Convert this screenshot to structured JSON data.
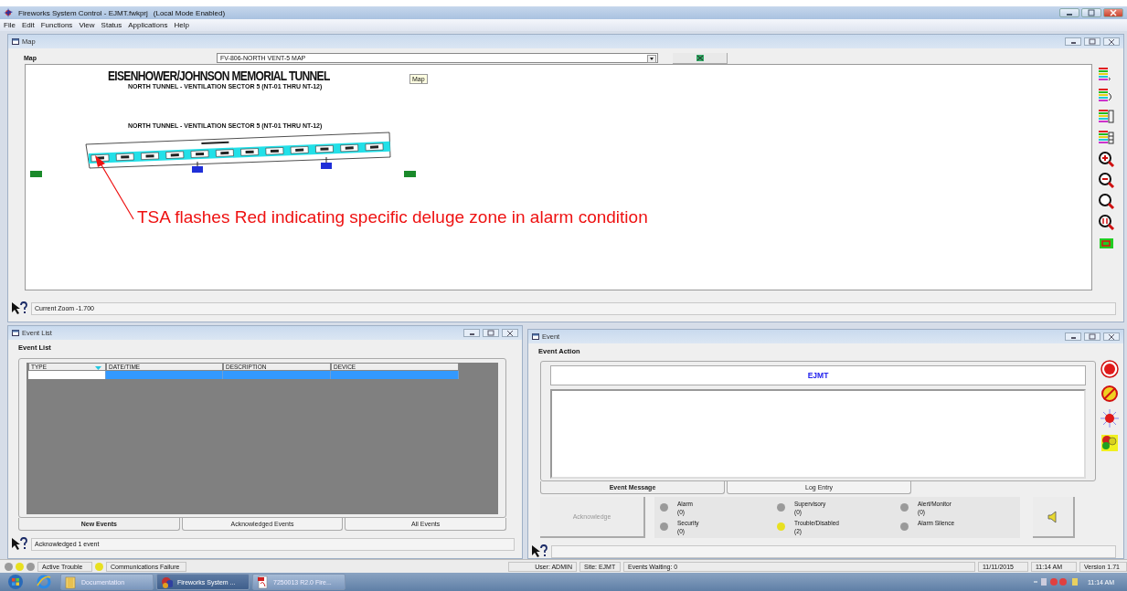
{
  "window": {
    "title": "Fireworks System Control - EJMT.fwkprj",
    "mode": "(Local Mode Enabled)"
  },
  "menu": [
    "File",
    "Edit",
    "Functions",
    "View",
    "Status",
    "Applications",
    "Help"
  ],
  "map_window": {
    "title": "Map",
    "map_label": "Map",
    "map_select": "FV-806-NORTH VENT-5 MAP",
    "map": {
      "title": "EISENHOWER/JOHNSON MEMORIAL TUNNEL",
      "subtitle": "NORTH TUNNEL - VENTILATION SECTOR 5 (NT-01 THRU NT-12)",
      "section_label": "NORTH TUNNEL - VENTILATION SECTOR 5 (NT-01 THRU NT-12)",
      "tooltip": "Map",
      "annotation": "TSA flashes Red indicating specific deluge zone in alarm condition"
    },
    "status": "Current Zoom -1.700"
  },
  "event_list_window": {
    "title": "Event List",
    "heading": "Event List",
    "columns": [
      "TYPE",
      "DATE/TIME",
      "DESCRIPTION",
      "DEVICE"
    ],
    "rows": [
      {
        "selected": true
      }
    ],
    "tabs": [
      {
        "label": "New Events",
        "selected": true
      },
      {
        "label": "Acknowledged Events",
        "selected": false
      },
      {
        "label": "All Events",
        "selected": false
      }
    ],
    "status": "Acknowledged 1 event"
  },
  "event_window": {
    "title": "Event",
    "heading": "Event Action",
    "site": "EJMT",
    "tabs": [
      {
        "label": "Event Message",
        "selected": true
      },
      {
        "label": "Log Entry",
        "selected": false
      }
    ],
    "acknowledge": {
      "label": "Acknowledge",
      "disabled": true
    },
    "indicators": [
      {
        "label": "Alarm",
        "count": "(0)",
        "color": "#9a9a9a"
      },
      {
        "label": "Supervisory",
        "count": "(0)",
        "color": "#9a9a9a"
      },
      {
        "label": "Alert/Monitor",
        "count": "(0)",
        "color": "#9a9a9a"
      },
      {
        "label": "Security",
        "count": "(0)",
        "color": "#9a9a9a"
      },
      {
        "label": "Trouble/Disabled",
        "count": "(2)",
        "color": "#e8e020"
      },
      {
        "label": "Alarm Silence",
        "color": "#9a9a9a"
      }
    ]
  },
  "status_bar": {
    "lights": [
      {
        "color": "#9a9a9a"
      },
      {
        "color": "#e8e020"
      },
      {
        "color": "#9a9a9a"
      }
    ],
    "active_trouble": "Active Trouble",
    "comm": {
      "label": "Communications Failure",
      "color": "#e8e020"
    },
    "user": "User: ADMIN",
    "site": "Site: EJMT",
    "events_waiting": "Events Waiting: 0",
    "date": "11/11/2015",
    "time": "11:14 AM",
    "version": "Version 1.71"
  },
  "taskbar": {
    "buttons": [
      {
        "label": "Documentation",
        "kind": "folder",
        "selected": false
      },
      {
        "label": "Fireworks System ...",
        "kind": "app",
        "selected": true
      },
      {
        "label": "7250013 R2.0 Fire...",
        "kind": "pdf",
        "selected": false
      }
    ],
    "clock": "11:14 AM"
  }
}
